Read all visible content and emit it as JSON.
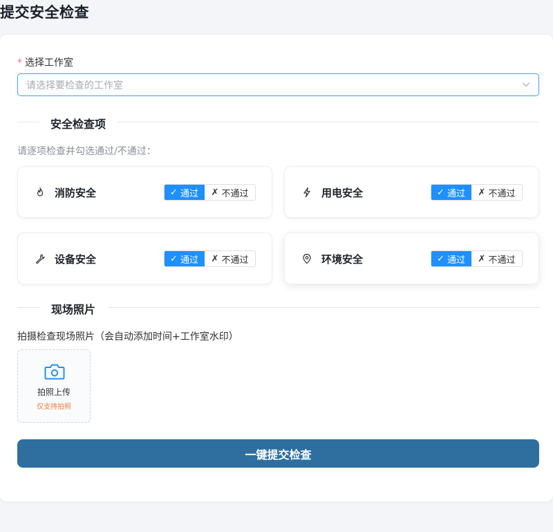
{
  "page": {
    "title": "提交安全检查"
  },
  "studio_field": {
    "required_mark": "*",
    "label": "选择工作室",
    "placeholder": "请选择要检查的工作室",
    "chevron_icon": "chevron-down-icon"
  },
  "checks_section": {
    "title": "安全检查项",
    "hint": "请逐项检查并勾选通过/不通过：",
    "options": {
      "pass_mark": "✓",
      "pass": "通过",
      "fail_mark": "✗",
      "fail": "不通过"
    },
    "items": [
      {
        "name": "消防安全",
        "icon": "flame-icon",
        "selected": "pass"
      },
      {
        "name": "用电安全",
        "icon": "lightning-icon",
        "selected": "pass"
      },
      {
        "name": "设备安全",
        "icon": "wrench-icon",
        "selected": "pass"
      },
      {
        "name": "环境安全",
        "icon": "location-pin-icon",
        "selected": "pass"
      }
    ]
  },
  "photo_section": {
    "title": "现场照片",
    "label": "拍摄检查现场照片（会自动添加时间+工作室水印）",
    "upload_text": "拍照上传",
    "upload_note": "仅支持拍照",
    "camera_icon": "camera-icon"
  },
  "submit": {
    "label": "一键提交检查"
  },
  "colors": {
    "accent": "#1e90ff",
    "submit_bg": "#2e6fa0",
    "required": "#f56c6c",
    "note": "#f08040"
  }
}
